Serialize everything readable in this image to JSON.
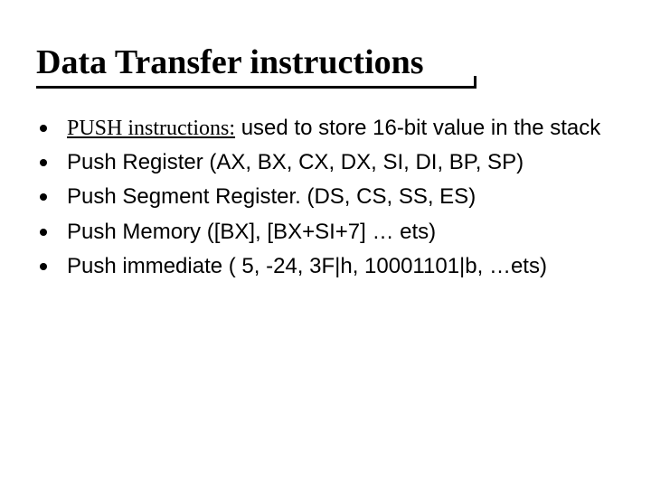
{
  "title": "Data Transfer instructions",
  "bullets": [
    {
      "lead": "PUSH instructions:",
      "rest": " used to store 16-bit value in the stack"
    },
    {
      "text": "Push Register (AX, BX, CX, DX, SI, DI, BP, SP)"
    },
    {
      "text": "Push Segment Register. (DS, CS, SS, ES)"
    },
    {
      "text": "Push Memory ([BX], [BX+SI+7] … ets)"
    },
    {
      "text": "Push immediate ( 5, -24, 3F|h, 10001101|b, …ets)"
    }
  ]
}
